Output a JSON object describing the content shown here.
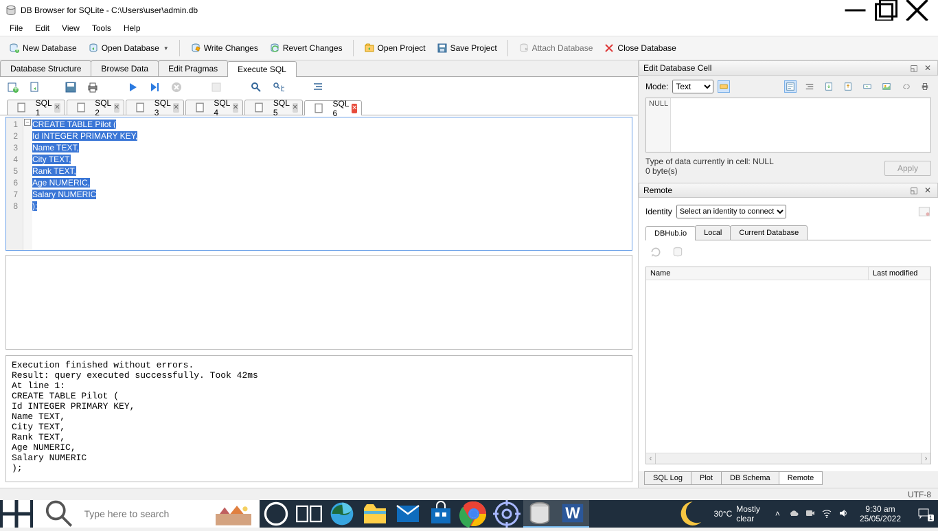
{
  "window": {
    "title": "DB Browser for SQLite - C:\\Users\\user\\admin.db"
  },
  "menubar": [
    "File",
    "Edit",
    "View",
    "Tools",
    "Help"
  ],
  "toolbar": {
    "new_db": "New Database",
    "open_db": "Open Database",
    "write_changes": "Write Changes",
    "revert_changes": "Revert Changes",
    "open_project": "Open Project",
    "save_project": "Save Project",
    "attach_db": "Attach Database",
    "close_db": "Close Database"
  },
  "main_tabs": {
    "db_structure": "Database Structure",
    "browse_data": "Browse Data",
    "edit_pragmas": "Edit Pragmas",
    "execute_sql": "Execute SQL"
  },
  "sql_tabs": [
    "SQL 1",
    "SQL 2",
    "SQL 3",
    "SQL 4",
    "SQL 5",
    "SQL 6"
  ],
  "sql_active_index": 5,
  "editor": {
    "line_count": 8,
    "lines": [
      "CREATE TABLE Pilot (",
      "Id INTEGER PRIMARY KEY,",
      "Name TEXT,",
      "City TEXT,",
      "Rank TEXT,",
      "Age NUMERIC,",
      "Salary NUMERIC",
      ");"
    ]
  },
  "output_text": "Execution finished without errors.\nResult: query executed successfully. Took 42ms\nAt line 1:\nCREATE TABLE Pilot (\nId INTEGER PRIMARY KEY,\nName TEXT,\nCity TEXT,\nRank TEXT,\nAge NUMERIC,\nSalary NUMERIC\n);",
  "cell_panel": {
    "title": "Edit Database Cell",
    "mode_label": "Mode:",
    "mode_value": "Text",
    "null_label": "NULL",
    "type_info": "Type of data currently in cell: NULL",
    "size_info": "0 byte(s)",
    "apply": "Apply"
  },
  "remote_panel": {
    "title": "Remote",
    "identity_label": "Identity",
    "identity_placeholder": "Select an identity to connect",
    "tabs": [
      "DBHub.io",
      "Local",
      "Current Database"
    ],
    "col_name": "Name",
    "col_modified": "Last modified"
  },
  "bottom_tabs": [
    "SQL Log",
    "Plot",
    "DB Schema",
    "Remote"
  ],
  "bottom_active": "Remote",
  "status": {
    "encoding": "UTF-8"
  },
  "taskbar": {
    "search_placeholder": "Type here to search",
    "weather_temp": "30°C",
    "weather_desc": "Mostly clear",
    "time": "9:30 am",
    "date": "25/05/2022",
    "notif_count": "1"
  }
}
